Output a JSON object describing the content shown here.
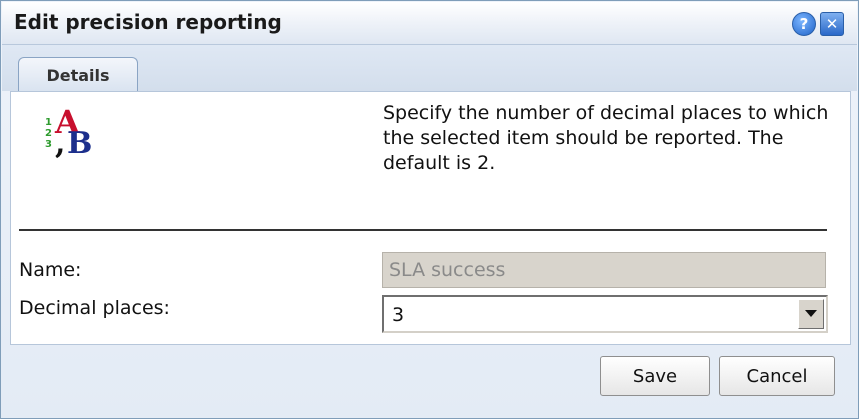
{
  "dialog": {
    "title": "Edit precision reporting",
    "help_icon": "help-icon",
    "close_icon": "close-icon"
  },
  "tabs": [
    {
      "label": "Details",
      "active": true
    }
  ],
  "description": "Specify the number of decimal places to which the selected item should be reported. The default is 2.",
  "icon": "ab-formatting-icon",
  "icon_glyphs": {
    "upper": "A",
    "lower": "B",
    "digits": [
      "1",
      "2",
      "3"
    ],
    "comma": ","
  },
  "form": {
    "name_label": "Name:",
    "name_value": "SLA success",
    "decimal_label": "Decimal places:",
    "decimal_value": "3"
  },
  "buttons": {
    "save": "Save",
    "cancel": "Cancel"
  },
  "colors": {
    "title_bar": "#dfe7f2",
    "panel": "#ffffff",
    "disabled_field": "#d8d4cc",
    "icon_red": "#c8102e",
    "icon_blue": "#1c2f8c",
    "icon_green": "#2e9b2e"
  }
}
